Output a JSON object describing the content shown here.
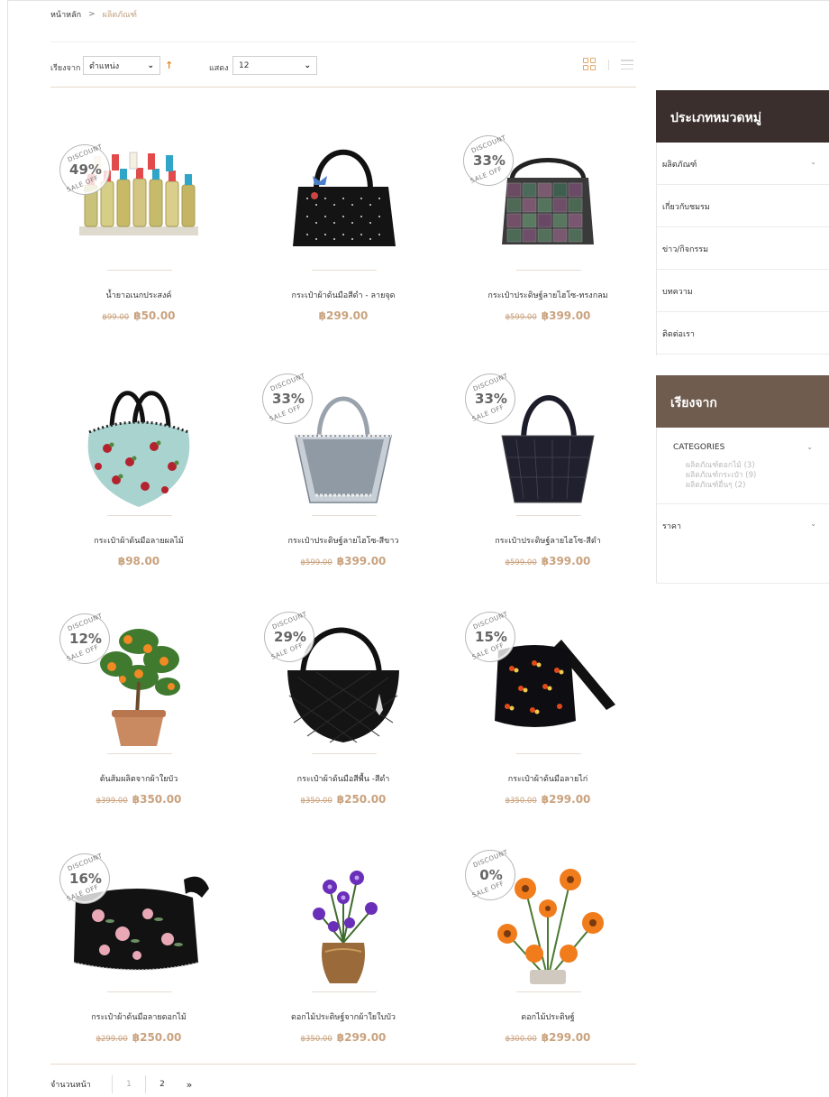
{
  "breadcrumb": {
    "home": "หน้าหลัก",
    "separator": ">",
    "current": "ผลิตภัณฑ์"
  },
  "toolbar": {
    "sort_label": "เรียงจาก",
    "sort_value": "ตำแหน่ง",
    "show_label": "แสดง",
    "show_value": "12"
  },
  "products": [
    {
      "name": "น้ำยาอเนกประสงค์",
      "old_price": "฿99.00",
      "price": "฿50.00",
      "discount": "49",
      "image": "bottles"
    },
    {
      "name": "กระเป๋าผ้าด้นมือสีดำ - ลายจุด",
      "old_price": "",
      "price": "฿299.00",
      "discount": "",
      "image": "black-dot-bag"
    },
    {
      "name": "กระเป๋าประดิษฐ์ลายไฮโซ-ทรงกลม",
      "old_price": "฿599.00",
      "price": "฿399.00",
      "discount": "33",
      "image": "geo-bag-round"
    },
    {
      "name": "กระเป๋าผ้าด้นมือลายผลไม้",
      "old_price": "",
      "price": "฿98.00",
      "discount": "",
      "image": "fruit-bag"
    },
    {
      "name": "กระเป๋าประดิษฐ์ลายไฮโซ-สีขาว",
      "old_price": "฿599.00",
      "price": "฿399.00",
      "discount": "33",
      "image": "white-basket"
    },
    {
      "name": "กระเป๋าประดิษฐ์ลายไฮโซ-สีดำ",
      "old_price": "฿599.00",
      "price": "฿399.00",
      "discount": "33",
      "image": "black-basket"
    },
    {
      "name": "ต้นส้มผลิตจากผ้าใยบัว",
      "old_price": "฿399.00",
      "price": "฿350.00",
      "discount": "12",
      "image": "orange-tree"
    },
    {
      "name": "กระเป๋าผ้าด้นมือสีพื้น -สีดำ",
      "old_price": "฿350.00",
      "price": "฿250.00",
      "discount": "29",
      "image": "black-quilt-bag"
    },
    {
      "name": "กระเป๋าผ้าด้นมือลายไก่",
      "old_price": "฿350.00",
      "price": "฿299.00",
      "discount": "15",
      "image": "chicken-bag"
    },
    {
      "name": "กระเป๋าผ้าด้นมือลายดอกไม้",
      "old_price": "฿299.00",
      "price": "฿250.00",
      "discount": "16",
      "image": "flower-bag"
    },
    {
      "name": "ดอกไม้ประดิษฐ์จากผ้าใยใบบัว",
      "old_price": "฿350.00",
      "price": "฿299.00",
      "discount": "",
      "image": "purple-flower-vase"
    },
    {
      "name": "ดอกไม้ประดิษฐ์",
      "old_price": "฿300.00",
      "price": "฿299.00",
      "discount": "0",
      "image": "orange-flowers"
    }
  ],
  "badge": {
    "top": "DISCOUNT",
    "bottom": "SALE OFF",
    "suffix": "%"
  },
  "pagination": {
    "label": "จำนวนหน้า",
    "pages": [
      "1",
      "2"
    ],
    "active": "1",
    "next": "»"
  },
  "sidebar": {
    "categories_title": "ประเภทหมวดหมู่",
    "categories": [
      "ผลิตภัณฑ์",
      "เกี่ยวกับชมรม",
      "ข่าว/กิจกรรม",
      "บทความ",
      "ติดต่อเรา"
    ],
    "sort_title": "เรียงจาก",
    "filter_title": "CATEGORIES",
    "filter_items": [
      "ผลิตภัณฑ์ดอกไม้ (3)",
      "ผลิตภัณฑ์กระเป๋า (9)",
      "ผลิตภัณฑ์อื่นๆ (2)"
    ],
    "price_title": "ราคา"
  },
  "colors": {
    "accent": "#c9a27e",
    "dark_header": "#3a2f2c",
    "brown_header": "#6f5c4f",
    "sort_arrow": "#e08a2a"
  }
}
